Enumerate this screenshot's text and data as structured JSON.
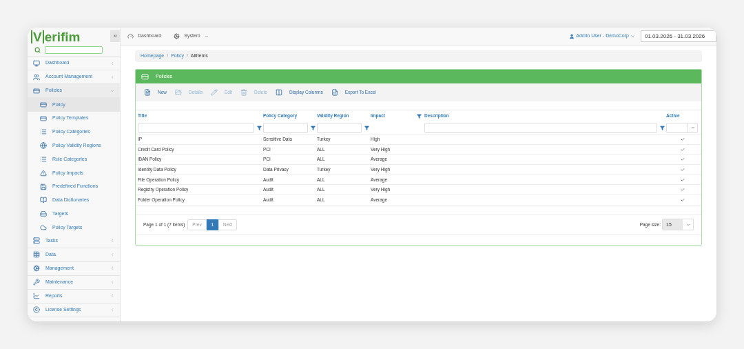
{
  "logo": {
    "boxed": "V",
    "rest": "erifim"
  },
  "collapse_button": {
    "label": "«"
  },
  "topnav": [
    {
      "label": "Dashboard",
      "dropdown": false
    },
    {
      "label": "System",
      "dropdown": true
    }
  ],
  "user_menu": {
    "label": "Admin User - DemoCorp"
  },
  "date_range": {
    "value": "01.03.2026 - 31.03.2026"
  },
  "sidebar": {
    "items": [
      {
        "label": "Dashboard",
        "selected": false,
        "expanded": false
      },
      {
        "label": "Account Management",
        "selected": false,
        "expanded": false
      },
      {
        "label": "Policies",
        "selected": false,
        "expanded": true,
        "children": [
          {
            "label": "Policy",
            "selected": true
          },
          {
            "label": "Policy Templates",
            "selected": false
          },
          {
            "label": "Policy Categories",
            "selected": false
          },
          {
            "label": "Policy Validity Regions",
            "selected": false
          },
          {
            "label": "Rule Categories",
            "selected": false
          },
          {
            "label": "Policy Impacts",
            "selected": false
          },
          {
            "label": "Predefined Functions",
            "selected": false
          },
          {
            "label": "Data Dictionaries",
            "selected": false
          },
          {
            "label": "Targets",
            "selected": false
          },
          {
            "label": "Policy Targets",
            "selected": false
          }
        ]
      },
      {
        "label": "Tasks",
        "selected": false,
        "expanded": false
      },
      {
        "label": "Data",
        "selected": false,
        "expanded": false
      },
      {
        "label": "Management",
        "selected": false,
        "expanded": false
      },
      {
        "label": "Maintenance",
        "selected": false,
        "expanded": false
      },
      {
        "label": "Reports",
        "selected": false,
        "expanded": false
      },
      {
        "label": "License Settings",
        "selected": false,
        "expanded": false
      }
    ]
  },
  "breadcrumb": [
    {
      "label": "Homepage",
      "current": false
    },
    {
      "separator": "/"
    },
    {
      "label": "Policy",
      "current": false
    },
    {
      "separator": "/"
    },
    {
      "label": "AllItems",
      "current": true
    }
  ],
  "panel": {
    "title": "Policies"
  },
  "toolbar": [
    {
      "label": "New",
      "disabled": false
    },
    {
      "label": "Details",
      "disabled": true
    },
    {
      "label": "Edit",
      "disabled": true
    },
    {
      "label": "Delete",
      "disabled": true
    },
    {
      "label": "Display Columns",
      "disabled": false
    },
    {
      "label": "Export To Excel",
      "disabled": false
    }
  ],
  "table": {
    "columns": [
      {
        "label": "Title",
        "kind": "text"
      },
      {
        "label": "Policy Category",
        "kind": "text"
      },
      {
        "label": "Validity Region",
        "kind": "text"
      },
      {
        "label": "Impact",
        "kind": "header"
      },
      {
        "label": "Description",
        "kind": "text"
      },
      {
        "label": "Active",
        "kind": "select"
      }
    ],
    "rows": [
      {
        "title": "IP",
        "category": "Sensitive Data",
        "region": "Turkey",
        "impact": "High",
        "active": true
      },
      {
        "title": "Credit Card Policy",
        "category": "PCI",
        "region": "ALL",
        "impact": "Very High",
        "active": true
      },
      {
        "title": "IBAN Policy",
        "category": "PCI",
        "region": "ALL",
        "impact": "Average",
        "active": true
      },
      {
        "title": "Identity Data Policy",
        "category": "Data Privacy",
        "region": "Turkey",
        "impact": "Very High",
        "active": true
      },
      {
        "title": "File Operation Policy",
        "category": "Audit",
        "region": "ALL",
        "impact": "Average",
        "active": true
      },
      {
        "title": "Registry Operation Policy",
        "category": "Audit",
        "region": "ALL",
        "impact": "Very High",
        "active": true
      },
      {
        "title": "Folder Operation Policy",
        "category": "Audit",
        "region": "ALL",
        "impact": "Average",
        "active": true
      }
    ]
  },
  "pager": {
    "info": "Page 1 of 1 (7 items)",
    "prev": "Prev",
    "next": "Next",
    "pages": [
      {
        "label": "1",
        "selected": true
      }
    ],
    "page_size_label": "Page size:",
    "page_size": "15"
  }
}
